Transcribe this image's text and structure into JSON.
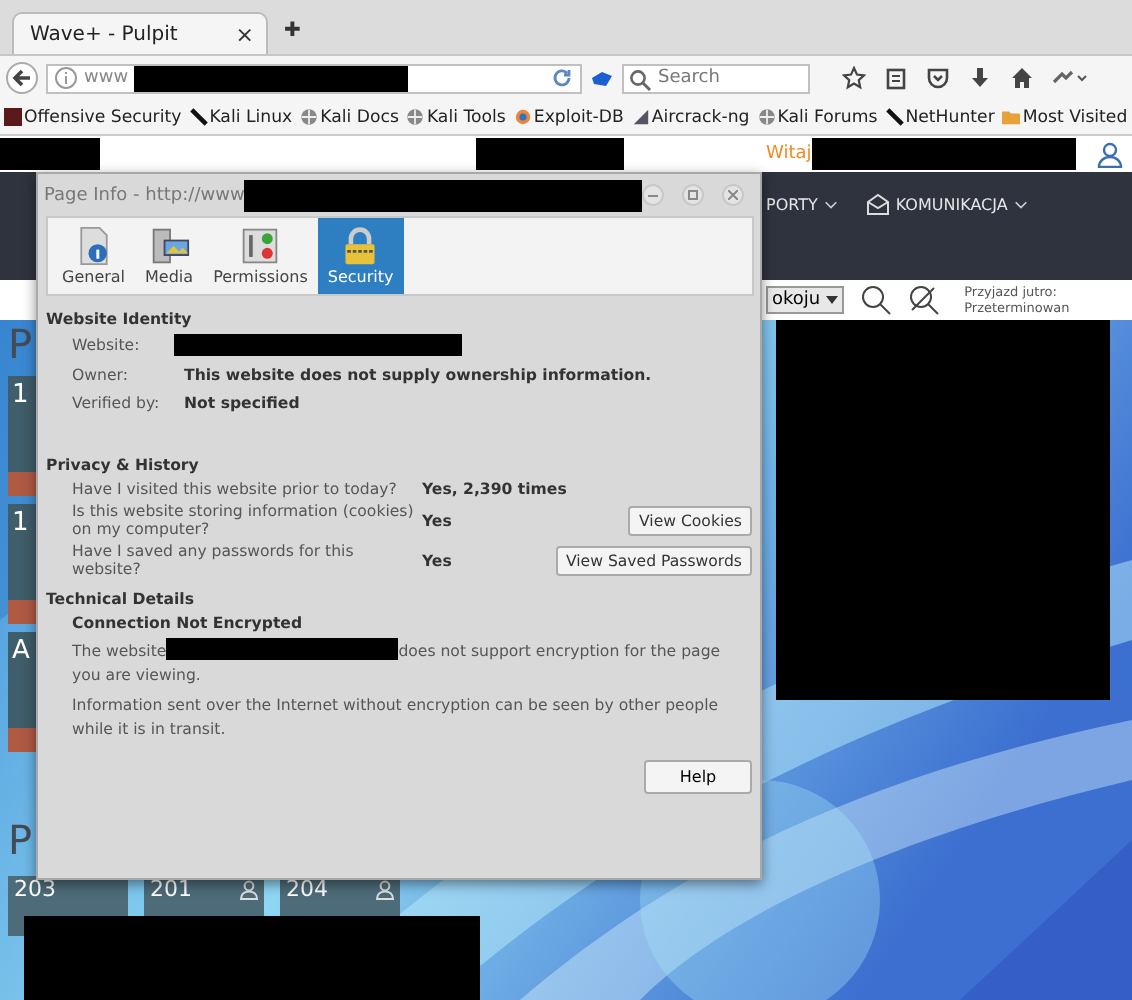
{
  "browser": {
    "tab_title": "Wave+ - Pulpit",
    "tab_close": "×",
    "new_tab": "✚",
    "url_prefix": "www",
    "search_placeholder": "Search",
    "bookmarks": [
      {
        "label": "Offensive Security",
        "kind": "square"
      },
      {
        "label": "Kali Linux",
        "kind": "slash"
      },
      {
        "label": "Kali Docs",
        "kind": "globe"
      },
      {
        "label": "Kali Tools",
        "kind": "globe"
      },
      {
        "label": "Exploit-DB",
        "kind": "spark"
      },
      {
        "label": "Aircrack-ng",
        "kind": "dish"
      },
      {
        "label": "Kali Forums",
        "kind": "globe"
      },
      {
        "label": "NetHunter",
        "kind": "slash"
      },
      {
        "label": "Most Visited",
        "kind": "folder"
      }
    ]
  },
  "site": {
    "greeting": "Witaj",
    "nav": [
      "PORTY",
      "KOMUNIKACJA"
    ],
    "room_select": "okoju",
    "notices": [
      "Przyjazd jutro:",
      "Przeterminowan"
    ],
    "left_tiles": [
      {
        "label": "1"
      },
      {
        "label": "1"
      },
      {
        "label": "A"
      }
    ],
    "section_letters": [
      "P",
      "P"
    ],
    "rooms": [
      {
        "number": "203",
        "occupied": false
      },
      {
        "number": "201",
        "occupied": true
      },
      {
        "number": "204",
        "occupied": true
      }
    ]
  },
  "dialog": {
    "title": "Page Info - http://www",
    "tabs": [
      {
        "label": "General",
        "kind": "general",
        "selected": false
      },
      {
        "label": "Media",
        "kind": "media",
        "selected": false
      },
      {
        "label": "Permissions",
        "kind": "permissions",
        "selected": false
      },
      {
        "label": "Security",
        "kind": "security",
        "selected": true
      }
    ],
    "identity": {
      "heading": "Website Identity",
      "website_label": "Website:",
      "owner_label": "Owner:",
      "owner_value": "This website does not supply ownership information.",
      "verified_label": "Verified by:",
      "verified_value": "Not specified"
    },
    "privacy": {
      "heading": "Privacy & History",
      "rows": [
        {
          "question": "Have I visited this website prior to today?",
          "answer": "Yes, 2,390 times"
        },
        {
          "question": "Is this website storing information (cookies) on my computer?",
          "answer": "Yes",
          "button": "View Cookies"
        },
        {
          "question": "Have I saved any passwords for this website?",
          "answer": "Yes",
          "button": "View Saved Passwords"
        }
      ]
    },
    "technical": {
      "heading": "Technical Details",
      "subheading": "Connection Not Encrypted",
      "paragraph1_before": "The website",
      "paragraph1_after": "does not support encryption for the page you are viewing.",
      "paragraph2": "Information sent over the Internet without encryption can be seen by other people while it is in transit."
    },
    "help_button": "Help"
  }
}
